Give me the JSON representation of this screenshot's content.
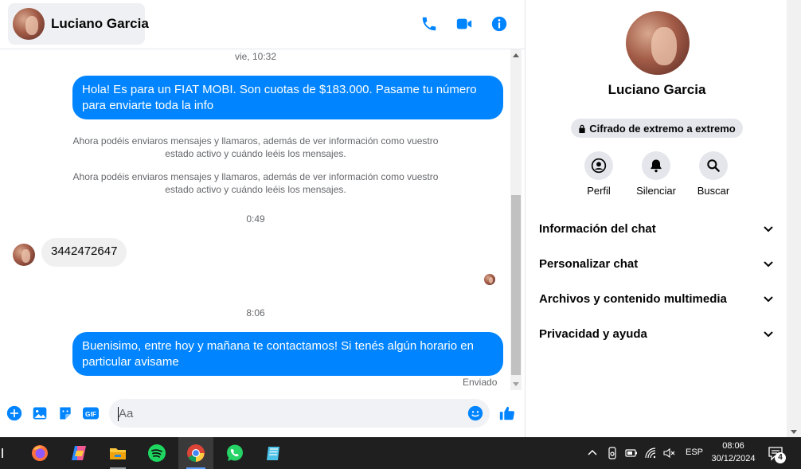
{
  "header": {
    "contact_name": "Luciano Garcia",
    "actions": [
      {
        "icon": "phone-icon"
      },
      {
        "icon": "video-icon"
      },
      {
        "icon": "info-icon"
      }
    ],
    "accent_color": "#0084ff"
  },
  "conversation": {
    "timestamp_1": "vie, 10:32",
    "message_1": "Hola! Es para un FIAT MOBI. Son cuotas de $183.000. Pasame tu número para enviarte toda la info",
    "system_note_1": "Ahora podéis enviaros mensajes y llamaros, además de ver información como vuestro estado activo y cuándo leéis los mensajes.",
    "system_note_2": "Ahora podéis enviaros mensajes y llamaros, además de ver información como vuestro estado activo y cuándo leéis los mensajes.",
    "timestamp_2": "0:49",
    "message_2": "3442472647",
    "timestamp_3": "8:06",
    "message_3": "Buenisimo, entre hoy y mañana te contactamos! Si tenés algún horario en particular avisame",
    "sent_status": "Enviado"
  },
  "composer": {
    "placeholder": "Aa",
    "icons": [
      "plus-icon",
      "photo-icon",
      "sticker-icon",
      "gif-icon",
      "emoji-icon",
      "like-icon"
    ],
    "gif_label": "GIF"
  },
  "info_panel": {
    "name": "Luciano Garcia",
    "encryption": "Cifrado de extremo a extremo",
    "actions": [
      {
        "label": "Perfil",
        "icon": "profile-icon"
      },
      {
        "label": "Silenciar",
        "icon": "bell-icon"
      },
      {
        "label": "Buscar",
        "icon": "search-icon"
      }
    ],
    "sections": [
      {
        "title": "Información del chat"
      },
      {
        "title": "Personalizar chat"
      },
      {
        "title": "Archivos y contenido multimedia"
      },
      {
        "title": "Privacidad y ayuda"
      }
    ]
  },
  "taskbar": {
    "apps": [
      "firefox-icon",
      "copilot-icon",
      "file-explorer-icon",
      "spotify-icon",
      "chrome-icon",
      "whatsapp-icon",
      "notepad-icon"
    ],
    "language": "ESP",
    "time": "08:06",
    "date": "30/12/2024",
    "notification_count": "4"
  }
}
